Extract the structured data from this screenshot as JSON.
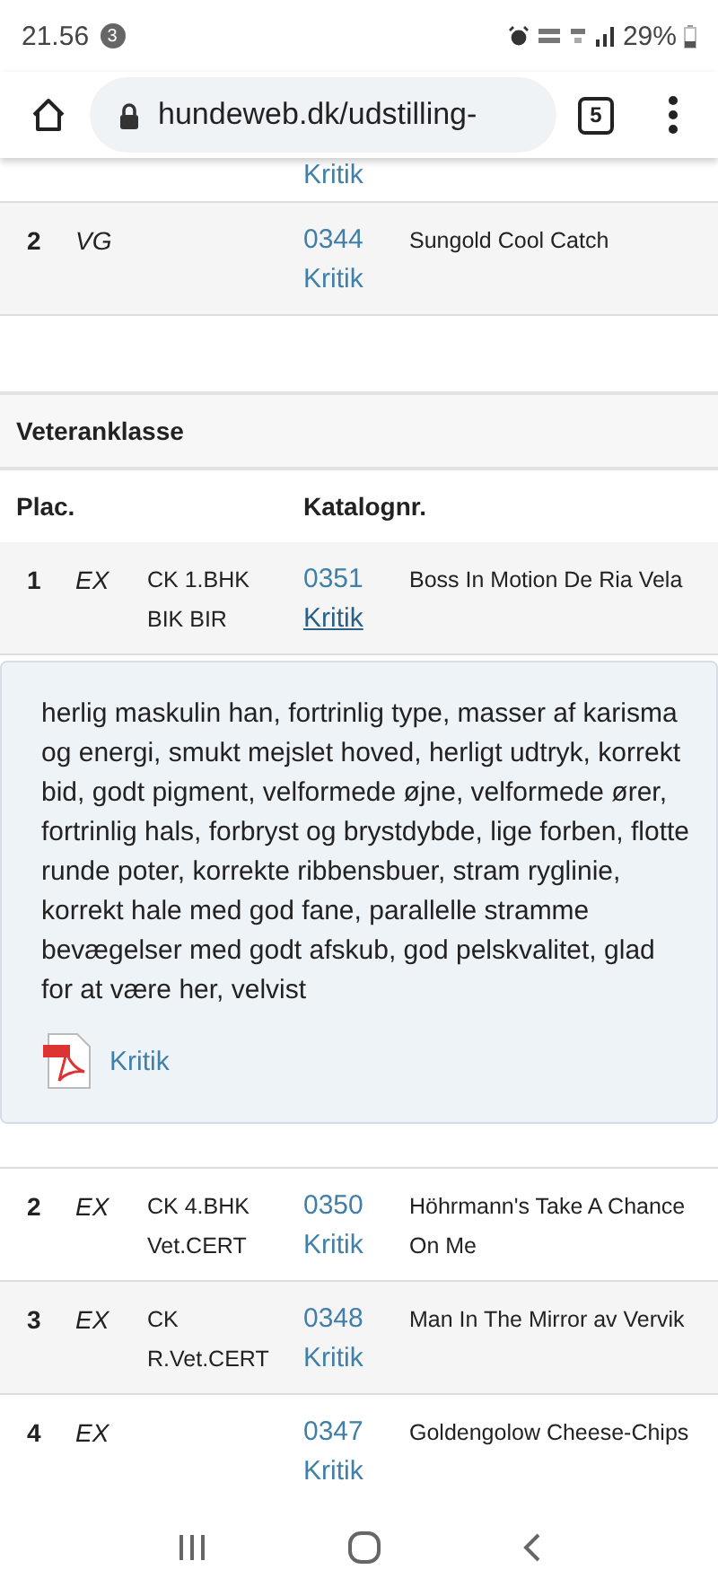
{
  "status_bar": {
    "time": "21.56",
    "notification_count": "3",
    "battery": "29%"
  },
  "browser": {
    "url": "hundeweb.dk/udstilling-",
    "tab_count": "5"
  },
  "previous_section": {
    "rows": [
      {
        "place": "2",
        "grade": "VG",
        "awards": [],
        "catalog": "0344",
        "link": "Kritik",
        "name": "Sungold Cool Catch",
        "expanded": false
      }
    ],
    "cut_link": "Kritik"
  },
  "section": {
    "title": "Veteranklasse",
    "columns": [
      "Plac.",
      "Katalognr."
    ],
    "rows": [
      {
        "place": "1",
        "grade": "EX",
        "awards": [
          "CK 1.BHK",
          "BIK BIR"
        ],
        "catalog": "0351",
        "link": "Kritik",
        "name": "Boss In Motion De Ria Vela",
        "expanded": true,
        "critique": "herlig maskulin han, fortrinlig type, masser af karisma og energi, smukt mejslet hoved, herligt udtryk, korrekt bid, godt pigment, velformede øjne, velformede ører, fortrinlig hals, forbryst og brystdybde, lige forben, flotte runde poter, korrekte ribbensbuer, stram ryglinie, korrekt hale med god fane, parallelle stramme bevægelser med godt afskub, god pelskvalitet, glad for at være her, velvist",
        "pdf_link": "Kritik"
      },
      {
        "place": "2",
        "grade": "EX",
        "awards": [
          "CK 4.BHK",
          "Vet.CERT"
        ],
        "catalog": "0350",
        "link": "Kritik",
        "name": "Höhrmann's Take A Chance On Me",
        "expanded": false
      },
      {
        "place": "3",
        "grade": "EX",
        "awards": [
          "CK",
          "R.Vet.CERT"
        ],
        "catalog": "0348",
        "link": "Kritik",
        "name": "Man In The Mirror av Vervik",
        "expanded": false
      },
      {
        "place": "4",
        "grade": "EX",
        "awards": [],
        "catalog": "0347",
        "link": "Kritik",
        "name": "Goldengolow Cheese-Chips",
        "expanded": false
      }
    ]
  }
}
